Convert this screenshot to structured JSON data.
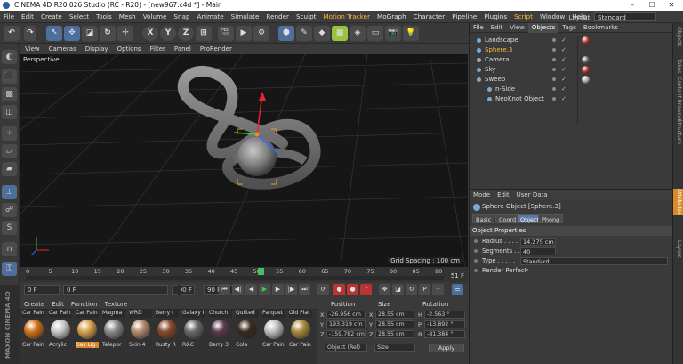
{
  "window": {
    "title": "CINEMA 4D R20.026 Studio (RC - R20) - [new967.c4d *] - Main"
  },
  "menubar": {
    "items": [
      "File",
      "Edit",
      "Create",
      "Select",
      "Tools",
      "Mesh",
      "Volume",
      "Snap",
      "Animate",
      "Simulate",
      "Render",
      "Sculpt",
      "Motion Tracker",
      "MoGraph",
      "Character",
      "Pipeline",
      "Plugins",
      "Script",
      "Window",
      "Help"
    ],
    "highlighted": [
      "Motion Tracker",
      "Script"
    ],
    "layout_label": "Layout:",
    "layout_value": "Standard"
  },
  "toolbar": {
    "undo": "undo-icon",
    "axis_x": "X",
    "axis_y": "Y",
    "axis_z": "Z"
  },
  "viewport": {
    "menu": [
      "View",
      "Cameras",
      "Display",
      "Options",
      "Filter",
      "Panel",
      "ProRender"
    ],
    "label": "Perspective",
    "grid_spacing": "Grid Spacing : 100 cm"
  },
  "timeline": {
    "ticks": [
      "0",
      "5",
      "10",
      "15",
      "20",
      "25",
      "30",
      "35",
      "40",
      "45",
      "50",
      "55",
      "60",
      "65",
      "70",
      "75",
      "80",
      "85",
      "90"
    ],
    "current_frame_marker": "51",
    "frame_indicator": "51 F",
    "playhead_fraction": 0.567
  },
  "transport": {
    "start": "0 F",
    "current": "0 F",
    "end_a": "90 F",
    "end_b": "90 F"
  },
  "materials": {
    "menu": [
      "Create",
      "Edit",
      "Function",
      "Texture"
    ],
    "items": [
      {
        "top": "Car Pain",
        "label": "Car Pain",
        "color": "#d4741b"
      },
      {
        "top": "Car Pain",
        "label": "Acrylic",
        "color": "#c9c9c9"
      },
      {
        "top": "Car Pain",
        "label": "Gas Lig",
        "color": "#d9a24a",
        "selected": true
      },
      {
        "top": "Magma",
        "label": "Telepor",
        "color": "#8a8a8a"
      },
      {
        "top": "WRD",
        "label": "Skin 4",
        "color": "#b08a6e"
      },
      {
        "top": "Berry I",
        "label": "Rusty R",
        "color": "#8b4a2b"
      },
      {
        "top": "Galaxy I",
        "label": "R&C",
        "color": "#6a6a6a"
      },
      {
        "top": "Church",
        "label": "Berry 3",
        "color": "#5a3a4a"
      },
      {
        "top": "Quilted",
        "label": "Cola",
        "color": "#3a2a20"
      },
      {
        "top": "Parquet",
        "label": "Car Pain",
        "color": "#c0c0c0"
      },
      {
        "top": "Old Plat",
        "label": "Car Pain",
        "color": "#a88a3a"
      }
    ]
  },
  "coordinates": {
    "headers": [
      "Position",
      "Size",
      "Rotation"
    ],
    "rows": [
      {
        "axis": "X",
        "pos": "-26.956 cm",
        "size_axis": "X",
        "size": "28.55 cm",
        "rot_axis": "H",
        "rot": "-2.563 °"
      },
      {
        "axis": "Y",
        "pos": "193.319 cm",
        "size_axis": "Y",
        "size": "28.55 cm",
        "rot_axis": "P",
        "rot": "-13.892 °"
      },
      {
        "axis": "Z",
        "pos": "-159.782 cm",
        "size_axis": "Z",
        "size": "28.55 cm",
        "rot_axis": "B",
        "rot": "-81.384 °"
      }
    ],
    "mode": "Object (Rel)",
    "size_mode": "Size",
    "apply": "Apply"
  },
  "objects": {
    "menu": [
      "File",
      "Edit",
      "View",
      "Objects",
      "Tags",
      "Bookmarks"
    ],
    "active_tab": "Objects",
    "rows": [
      {
        "name": "Landscape",
        "indent": 0,
        "selected": false,
        "color": "#7aa7d8",
        "tag": "#b33"
      },
      {
        "name": "Sphere.3",
        "indent": 0,
        "selected": true,
        "color": "#7aa7d8",
        "tag": ""
      },
      {
        "name": "Camera",
        "indent": 0,
        "selected": false,
        "color": "#aaaaaa",
        "tag": "#666"
      },
      {
        "name": "Sky",
        "indent": 0,
        "selected": false,
        "color": "#7aa7d8",
        "tag": "#b33"
      },
      {
        "name": "Sweep",
        "indent": 0,
        "selected": false,
        "color": "#7aa7d8",
        "tag": "#aaa"
      },
      {
        "name": "n-Side",
        "indent": 1,
        "selected": false,
        "color": "#7aa7d8",
        "tag": ""
      },
      {
        "name": "NeoKnot Object",
        "indent": 1,
        "selected": false,
        "color": "#7aa7d8",
        "tag": ""
      }
    ]
  },
  "attributes": {
    "menu": [
      "Mode",
      "Edit",
      "User Data"
    ],
    "title": "Sphere Object [Sphere.3]",
    "tabs": [
      "Basic",
      "Coord.",
      "Object",
      "Phong"
    ],
    "active_tab": "Object",
    "section": "Object Properties",
    "props": [
      {
        "label": "Radius . . . . . .",
        "value": "14.275 cm"
      },
      {
        "label": "Segments . . . .",
        "value": "40"
      },
      {
        "label": "Type . . . . . . .",
        "value": "Standard"
      },
      {
        "label": "Render Perfect",
        "value": "✓"
      }
    ]
  },
  "right_strip": [
    "Objects",
    "Takes",
    "Content Browser",
    "Structure",
    "Attributes",
    "Layers"
  ],
  "brand": "MAXON CINEMA 4D"
}
